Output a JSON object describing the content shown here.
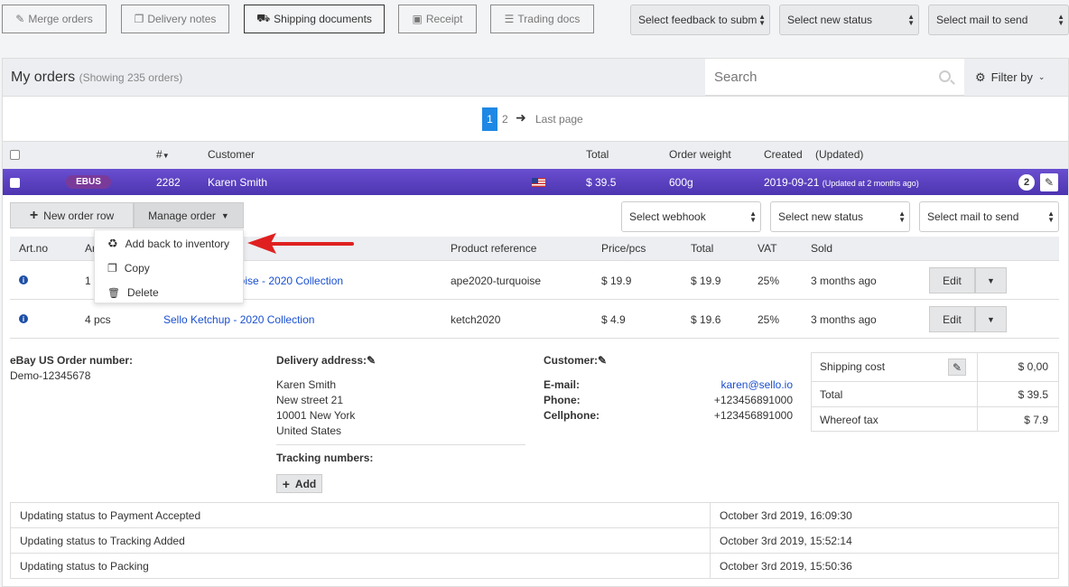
{
  "toolbar": {
    "merge_orders": "Merge orders",
    "delivery_notes": "Delivery notes",
    "shipping_documents": "Shipping documents",
    "receipt": "Receipt",
    "trading_docs": "Trading docs",
    "select_feedback": "Select feedback to subm",
    "select_status": "Select new status",
    "select_mail": "Select mail to send"
  },
  "orders": {
    "title": "My orders",
    "showing": "(Showing 235 orders)",
    "search_placeholder": "Search",
    "filter_label": "Filter by"
  },
  "pagination": {
    "pages": [
      "1",
      "2"
    ],
    "current": "1",
    "last_page": "Last page"
  },
  "table_header": {
    "num": "#",
    "customer": "Customer",
    "total": "Total",
    "order_weight": "Order weight",
    "created": "Created",
    "updated": "(Updated)"
  },
  "order": {
    "badge": "EBUS",
    "number": "2282",
    "customer": "Karen Smith",
    "total": "$ 39.5",
    "weight": "600g",
    "created": "2019-09-21",
    "updated": "(Updated at 2 months ago)",
    "count": "2"
  },
  "actions": {
    "new_order_row": "New order row",
    "manage_order": "Manage order",
    "select_webhook": "Select webhook",
    "select_status": "Select new status",
    "select_mail": "Select mail to send"
  },
  "menu": {
    "add_back": "Add back to inventory",
    "copy": "Copy",
    "delete": "Delete"
  },
  "rows_header": {
    "art_no": "Art.no",
    "amount": "Ar",
    "product_ref": "Product reference",
    "price": "Price/pcs",
    "total": "Total",
    "vat": "VAT",
    "sold": "Sold"
  },
  "rows": [
    {
      "qty": "1 p",
      "product": "uoise - 2020 Collection",
      "ref": "ape2020-turquoise",
      "price": "$ 19.9",
      "total": "$ 19.9",
      "vat": "25%",
      "sold": "3 months ago",
      "edit": "Edit"
    },
    {
      "qty": "4 pcs",
      "product": "Sello Ketchup - 2020 Collection",
      "ref": "ketch2020",
      "price": "$ 4.9",
      "total": "$ 19.6",
      "vat": "25%",
      "sold": "3 months ago",
      "edit": "Edit"
    }
  ],
  "details": {
    "ebay_label": "eBay US Order number:",
    "ebay_value": "Demo-12345678",
    "delivery_label": "Delivery address:",
    "address": [
      "Karen Smith",
      "New street 21",
      "10001 New York",
      "United States"
    ],
    "tracking_label": "Tracking numbers:",
    "add_label": "Add",
    "customer_label": "Customer:",
    "email_label": "E-mail:",
    "email_value": "karen@sello.io",
    "phone_label": "Phone:",
    "phone_value": "+123456891000",
    "cell_label": "Cellphone:",
    "cell_value": "+123456891000"
  },
  "costs": {
    "shipping_label": "Shipping cost",
    "shipping_value": "$ 0,00",
    "total_label": "Total",
    "total_value": "$ 39.5",
    "tax_label": "Whereof tax",
    "tax_value": "$ 7.9"
  },
  "log": [
    {
      "text": "Updating status to Payment Accepted",
      "time": "October 3rd 2019, 16:09:30"
    },
    {
      "text": "Updating status to Tracking Added",
      "time": "October 3rd 2019, 15:52:14"
    },
    {
      "text": "Updating status to Packing",
      "time": "October 3rd 2019, 15:50:36"
    }
  ],
  "colors": {
    "order_row": "#5b3fc0",
    "badge": "#7a3a9a",
    "arrow": "#e02020",
    "link": "#1a4fd0",
    "page_active": "#1e88e5"
  }
}
